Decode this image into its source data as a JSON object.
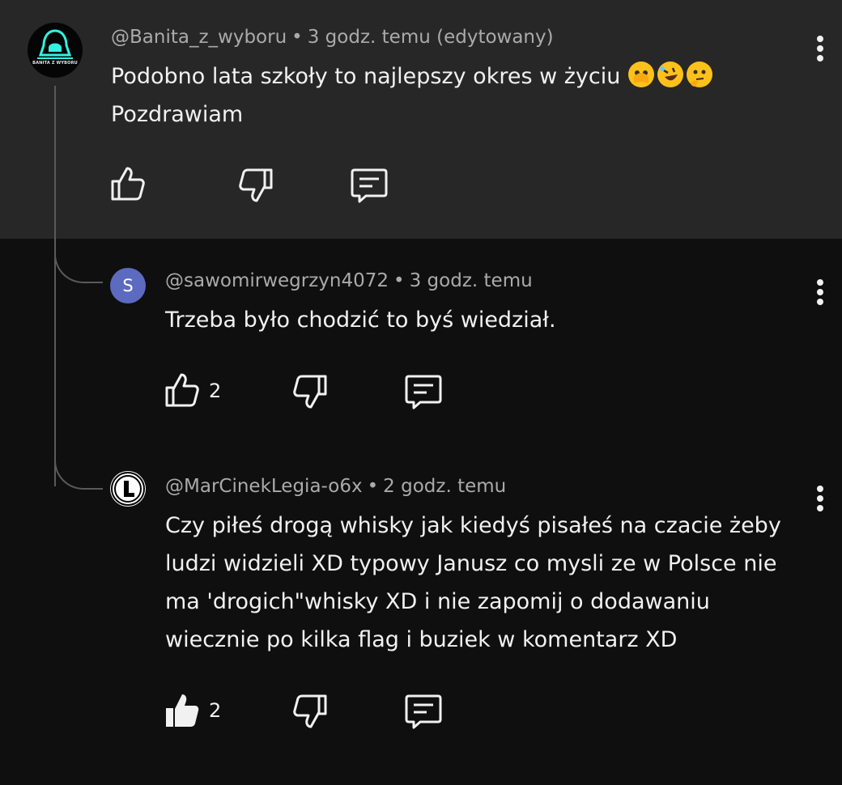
{
  "comments": [
    {
      "author": "@Banita_z_wyboru",
      "time": "3 godz. temu (edytowany)",
      "text_line1": "Podobno lata szkoły to najlepszy okres w życiu",
      "text_line2": "Pozdrawiam",
      "emojis": [
        "face-with-peeking-eye",
        "rolling-on-floor-laughing",
        "thinking-face"
      ],
      "avatar_label": "BANITA Z WYBORU",
      "likes": ""
    },
    {
      "author": "@sawomirwegrzyn4072",
      "time": "3 godz. temu",
      "text_line1": "Trzeba było chodzić to byś wiedział.",
      "avatar_letter": "S",
      "avatar_color": "#5c6bc0",
      "likes": "2"
    },
    {
      "author": "@MarCinekLegia-o6x",
      "time": "2 godz. temu",
      "text_lines": [
        "Czy piłeś drogą whisky jak kiedyś pisałeś na czacie żeby",
        "ludzi widzieli XD typowy Janusz co mysli ze w Polsce nie",
        "ma 'drogich\"whisky XD i nie zapomij o dodawaniu",
        "wiecznie po kilka flag i buziek w komentarz XD"
      ],
      "likes": "2",
      "liked": true
    }
  ],
  "separator": "•",
  "colors": {
    "top_background": "#272727",
    "background": "#0f0f0f",
    "meta_text": "#aaaaaa",
    "text": "#f1f1f1",
    "thread_line": "#5a5a5a"
  },
  "icons": [
    "like-icon",
    "dislike-icon",
    "reply-icon",
    "more-options-icon"
  ]
}
